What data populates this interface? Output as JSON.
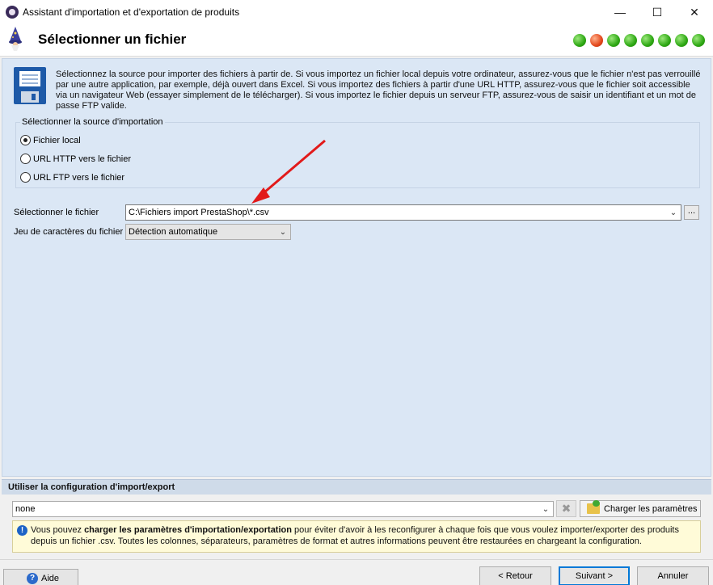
{
  "window": {
    "title": "Assistant d'importation et d'exportation de produits",
    "minimize": "—",
    "maximize": "☐",
    "close": "✕"
  },
  "header": {
    "title": "Sélectionner un fichier",
    "steps": [
      {
        "state": "done"
      },
      {
        "state": "current"
      },
      {
        "state": "done"
      },
      {
        "state": "done"
      },
      {
        "state": "done"
      },
      {
        "state": "done"
      },
      {
        "state": "done"
      },
      {
        "state": "done"
      }
    ]
  },
  "intro": {
    "icon": "floppy-disk-icon",
    "text": "Sélectionnez la source pour importer des fichiers à partir de. Si vous importez un fichier local depuis votre ordinateur, assurez-vous que le fichier n'est pas verrouillé par une autre application, par exemple, déjà ouvert dans Excel. Si vous importez des fichiers à partir d'une URL HTTP, assurez-vous que le fichier soit accessible via un navigateur Web (essayer simplement de le télécharger). Si vous importez le fichier depuis un serveur FTP, assurez-vous de saisir un identifiant et un mot de passe FTP valide."
  },
  "source": {
    "label": "Sélectionner la source d'importation",
    "options": [
      {
        "label": "Fichier local",
        "checked": true
      },
      {
        "label": "URL HTTP vers le fichier",
        "checked": false
      },
      {
        "label": "URL FTP vers le fichier",
        "checked": false
      }
    ]
  },
  "file": {
    "label": "Sélectionner le fichier",
    "value": "C:\\Fichiers import PrestaShop\\*.csv",
    "browse_label": "..."
  },
  "charset": {
    "label": "Jeu de caractères du fichier",
    "value": "Détection automatique"
  },
  "config": {
    "header": "Utiliser la configuration d'import/export",
    "value": "none",
    "load_label": "Charger les paramètres",
    "hint_prefix": "Vous pouvez ",
    "hint_bold": "charger les paramètres d'importation/exportation",
    "hint_suffix": " pour éviter d'avoir à les reconfigurer à chaque fois que vous voulez importer/exporter des produits depuis un fichier .csv. Toutes les colonnes, séparateurs, paramètres de format et autres informations peuvent être restaurées en chargeant la configuration."
  },
  "footer": {
    "help": "Aide",
    "back": "< Retour",
    "next": "Suivant >",
    "cancel": "Annuler"
  },
  "colors": {
    "panel": "#dbe7f5",
    "annotation_arrow": "#e21a1a",
    "step_done": "#2ea814",
    "step_current": "#e3471c"
  }
}
